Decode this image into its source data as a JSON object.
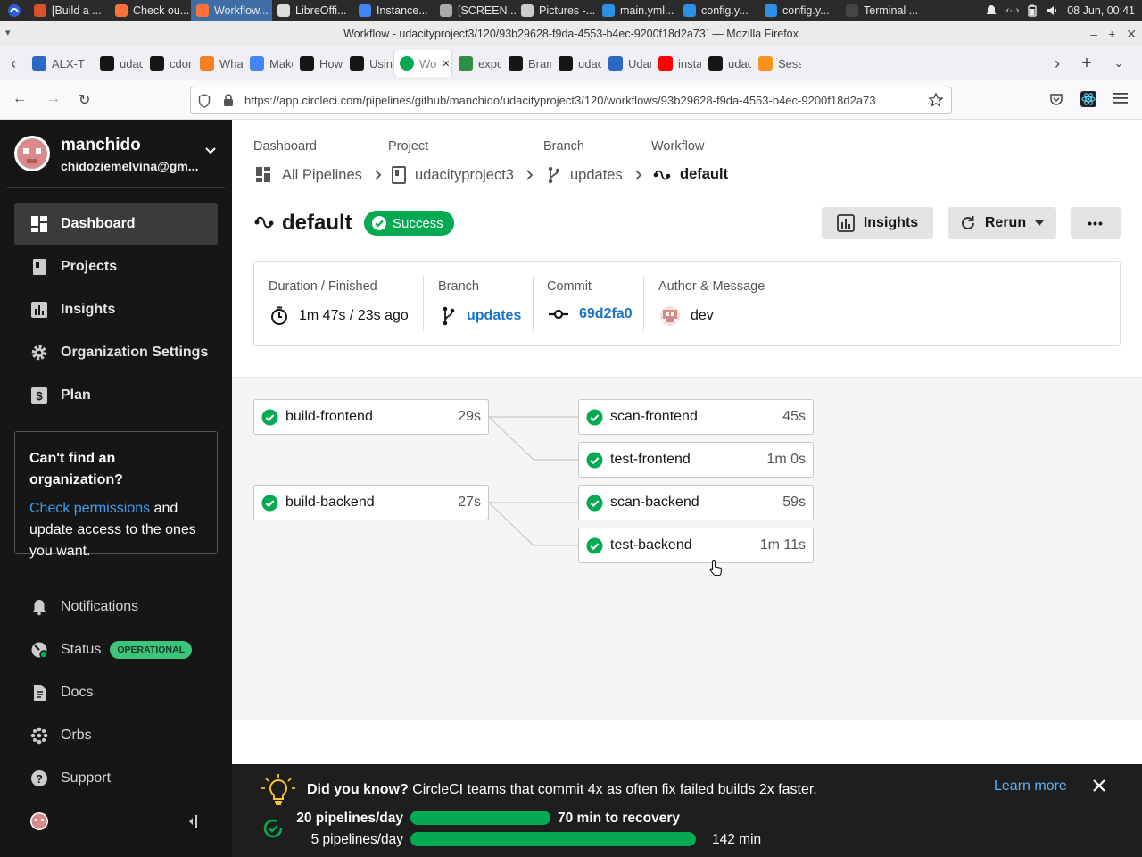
{
  "taskbar": {
    "items": [
      {
        "label": "[Build a ...",
        "color": "#d9512c"
      },
      {
        "label": "Check ou...",
        "color": "#ff7139"
      },
      {
        "label": "Workflow...",
        "color": "#ff7139",
        "active": true
      },
      {
        "label": "LibreOffi...",
        "color": "#dddddd"
      },
      {
        "label": "Instance...",
        "color": "#4285f4"
      },
      {
        "label": "[SCREEN...",
        "color": "#aaaaaa"
      },
      {
        "label": "Pictures -...",
        "color": "#cccccc"
      },
      {
        "label": "main.yml...",
        "color": "#2d8fe6"
      },
      {
        "label": "config.y...",
        "color": "#2d8fe6"
      },
      {
        "label": "config.y...",
        "color": "#2d8fe6"
      },
      {
        "label": "Terminal ...",
        "color": "#444444"
      }
    ],
    "clock": "08 Jun, 00:41"
  },
  "window": {
    "title": "Workflow - udacityproject3/120/93b29628-f9da-4553-b4ec-9200f18d2a73` — Mozilla Firefox"
  },
  "tabs": [
    {
      "label": "ALX-T",
      "color": "#2d68c4"
    },
    {
      "label": "udaci",
      "color": "#161616"
    },
    {
      "label": "cdonc",
      "color": "#161616"
    },
    {
      "label": "What",
      "color": "#f48024"
    },
    {
      "label": "Make",
      "color": "#4285f4"
    },
    {
      "label": "How t",
      "color": "#161616"
    },
    {
      "label": "Using",
      "color": "#161616"
    },
    {
      "label": "Wo",
      "color": "#04aa51",
      "active": true
    },
    {
      "label": "expor",
      "color": "#2f8d46"
    },
    {
      "label": "Branc",
      "color": "#161616"
    },
    {
      "label": "udaci",
      "color": "#161616"
    },
    {
      "label": "Udaci",
      "color": "#2d68c4"
    },
    {
      "label": "instal",
      "color": "#ff0000"
    },
    {
      "label": "udaci",
      "color": "#161616"
    },
    {
      "label": "Sessic",
      "color": "#f7931e"
    }
  ],
  "url": "https://app.circleci.com/pipelines/github/manchido/udacityproject3/120/workflows/93b29628-f9da-4553-b4ec-9200f18d2a73",
  "sidebar": {
    "username": "manchido",
    "email": "chidoziemelvina@gm...",
    "nav": [
      {
        "label": "Dashboard",
        "icon": "dashboard-icon"
      },
      {
        "label": "Projects",
        "icon": "projects-icon"
      },
      {
        "label": "Insights",
        "icon": "insights-icon"
      },
      {
        "label": "Organization Settings",
        "icon": "gear-icon"
      },
      {
        "label": "Plan",
        "icon": "plan-icon"
      }
    ],
    "org_box": {
      "title": "Can't find an organization?",
      "link": "Check permissions",
      "text_after_link": " and",
      "text_rest": "update access to the ones you want."
    },
    "bottom": [
      {
        "label": "Notifications",
        "icon": "bell-icon"
      },
      {
        "label": "Status",
        "icon": "status-icon",
        "badge": "OPERATIONAL"
      },
      {
        "label": "Docs",
        "icon": "docs-icon"
      },
      {
        "label": "Orbs",
        "icon": "orbs-icon"
      },
      {
        "label": "Support",
        "icon": "support-icon"
      }
    ]
  },
  "breadcrumb": {
    "dashboard_label": "Dashboard",
    "dashboard_value": "All Pipelines",
    "project_label": "Project",
    "project_value": "udacityproject3",
    "branch_label": "Branch",
    "branch_value": "updates",
    "workflow_label": "Workflow",
    "workflow_value": "default"
  },
  "workflow": {
    "name": "default",
    "status": "Success",
    "insights_button": "Insights",
    "rerun_button": "Rerun",
    "more_button": "•••"
  },
  "summary": {
    "duration_label": "Duration / Finished",
    "duration_value": "1m 47s / 23s ago",
    "branch_label": "Branch",
    "branch_value": "updates",
    "commit_label": "Commit",
    "commit_value": "69d2fa0",
    "author_label": "Author & Message",
    "author_message": "dev"
  },
  "jobs": [
    {
      "name": "build-frontend",
      "duration": "29s",
      "status": "success"
    },
    {
      "name": "scan-frontend",
      "duration": "45s",
      "status": "success"
    },
    {
      "name": "test-frontend",
      "duration": "1m 0s",
      "status": "success"
    },
    {
      "name": "build-backend",
      "duration": "27s",
      "status": "success"
    },
    {
      "name": "scan-backend",
      "duration": "59s",
      "status": "success"
    },
    {
      "name": "test-backend",
      "duration": "1m 11s",
      "status": "success"
    }
  ],
  "banner": {
    "title": "Did you know?",
    "text": "CircleCI teams that commit 4x as often fix failed builds 2x faster.",
    "learn_more": "Learn more",
    "row1_left": "20 pipelines/day",
    "row1_right": "70 min to recovery",
    "row1_fraction": 0.49,
    "row2_left": "5 pipelines/day",
    "row2_right": "142 min",
    "row2_fraction": 1.0
  },
  "colors": {
    "success": "#04aa51",
    "link": "#1a73c9",
    "sidebar_bg": "#161616"
  }
}
